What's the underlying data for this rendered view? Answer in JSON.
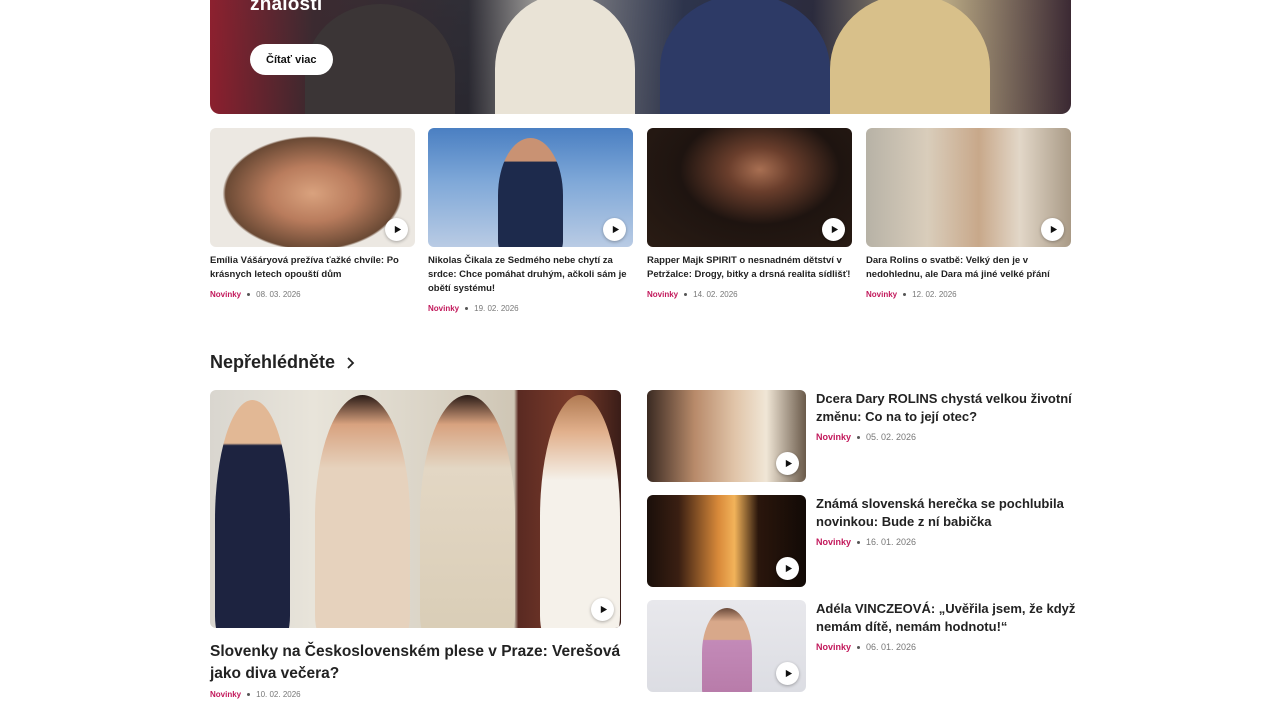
{
  "hero": {
    "title": "znalosti",
    "button_label": "Čítať viac"
  },
  "cards": [
    {
      "title": "Emília Vášáryová prežíva ťažké chvíle: Po krásnych letech opouští dům",
      "category": "Novinky",
      "date": "08. 03. 2026"
    },
    {
      "title": "Nikolas Čikala ze Sedmého nebe chytí za srdce: Chce pomáhat druhým, ačkoli sám je obětí systému!",
      "category": "Novinky",
      "date": "19. 02. 2026"
    },
    {
      "title": "Rapper Majk SPIRIT o nesnadném dětství v Petržalce: Drogy, bitky a drsná realita sídlišť!",
      "category": "Novinky",
      "date": "14. 02. 2026"
    },
    {
      "title": "Dara Rolins o svatbě: Velký den je v nedohlednu, ale Dara má jiné velké přání",
      "category": "Novinky",
      "date": "12. 02. 2026"
    }
  ],
  "section": {
    "title": "Nepřehlédněte"
  },
  "featured": {
    "title": "Slovenky na Československém plese v Praze: Verešová jako diva večera?",
    "category": "Novinky",
    "date": "10. 02. 2026"
  },
  "side_items": [
    {
      "title": "Dcera Dary ROLINS chystá velkou životní změnu: Co na to její otec?",
      "category": "Novinky",
      "date": "05. 02. 2026"
    },
    {
      "title": "Známá slovenská herečka se pochlubila novinkou: Bude z ní babička",
      "category": "Novinky",
      "date": "16. 01. 2026"
    },
    {
      "title": "Adéla VINCZEOVÁ: „Uvěřila jsem, že když nemám dítě, nemám hodnotu!“",
      "category": "Novinky",
      "date": "06. 01. 2026"
    }
  ],
  "colors": {
    "accent": "#c2185b"
  }
}
